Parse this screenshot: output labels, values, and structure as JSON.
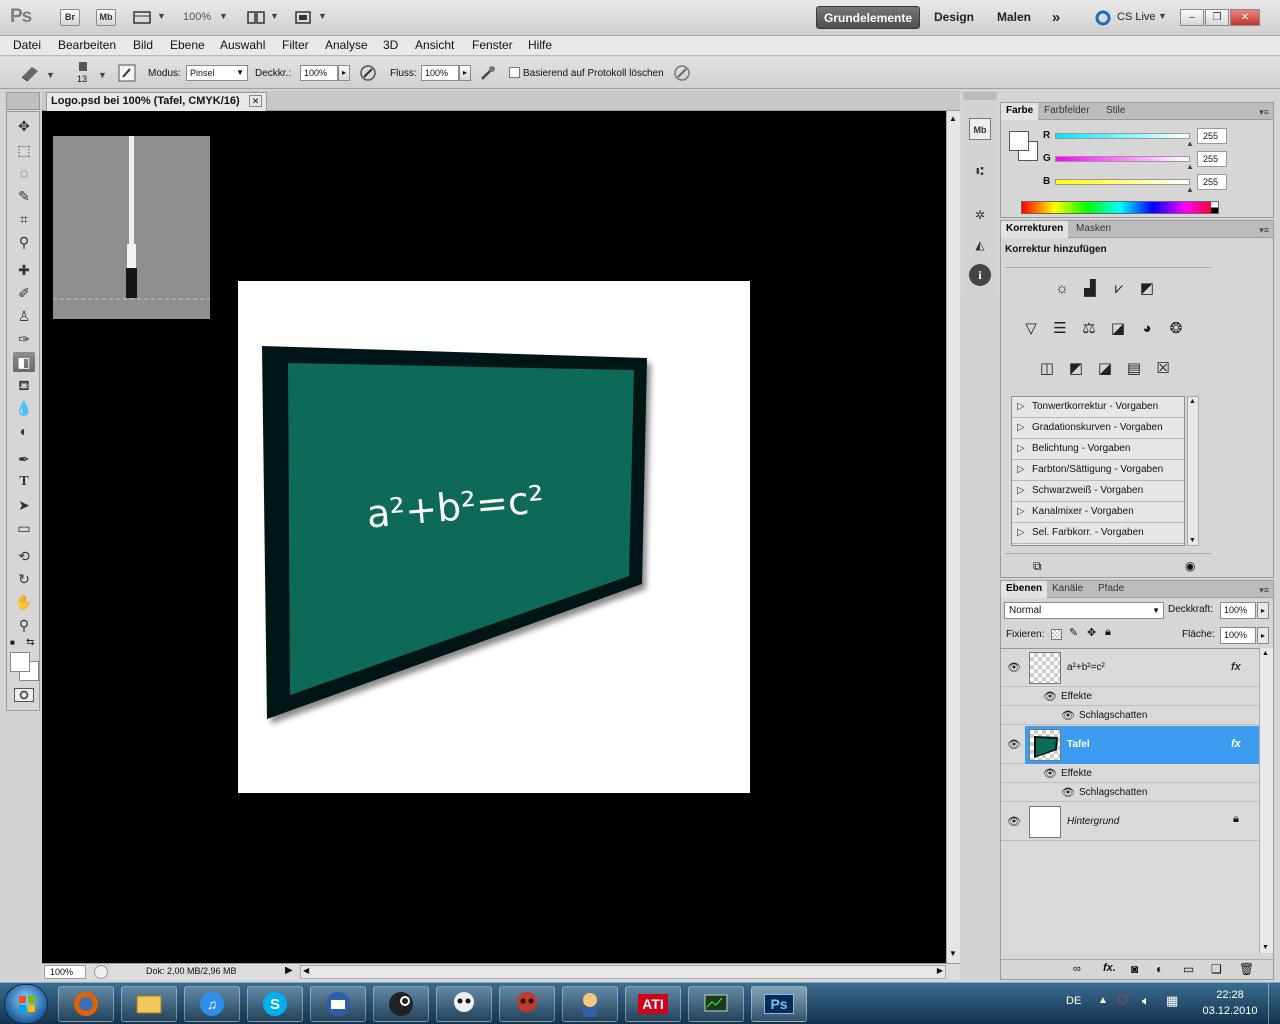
{
  "appbar": {
    "logo": "Ps",
    "bridge": "Br",
    "minibridge": "Mb",
    "zoom": "100%",
    "workspaces": [
      "Grundelemente",
      "Design",
      "Malen"
    ],
    "more": "»",
    "cslive": "CS Live"
  },
  "menu": [
    "Datei",
    "Bearbeiten",
    "Bild",
    "Ebene",
    "Auswahl",
    "Filter",
    "Analyse",
    "3D",
    "Ansicht",
    "Fenster",
    "Hilfe"
  ],
  "options": {
    "brush_size": "13",
    "mode_label": "Modus:",
    "mode_value": "Pinsel",
    "opacity_label": "Deckkr.:",
    "opacity_value": "100%",
    "flow_label": "Fluss:",
    "flow_value": "100%",
    "history_label": "Basierend auf Protokoll löschen"
  },
  "document": {
    "tab_title": "Logo.psd bei 100% (Tafel, CMYK/16)",
    "formula": "a²+b²=c²",
    "status_zoom": "100%",
    "status_doc": "Dok: 2,00 MB/2,96 MB"
  },
  "color_panel": {
    "tabs": [
      "Farbe",
      "Farbfelder",
      "Stile"
    ],
    "channels": [
      {
        "label": "R",
        "value": "255",
        "color": "#00e5ff"
      },
      {
        "label": "G",
        "value": "255",
        "color": "#ff00ff"
      },
      {
        "label": "B",
        "value": "255",
        "color": "#ffff00"
      }
    ]
  },
  "adjust_panel": {
    "tabs": [
      "Korrekturen",
      "Masken"
    ],
    "heading": "Korrektur hinzufügen",
    "presets": [
      "Tonwertkorrektur - Vorgaben",
      "Gradationskurven - Vorgaben",
      "Belichtung - Vorgaben",
      "Farbton/Sättigung - Vorgaben",
      "Schwarzweiß - Vorgaben",
      "Kanalmixer - Vorgaben",
      "Sel. Farbkorr. - Vorgaben"
    ]
  },
  "layers_panel": {
    "tabs": [
      "Ebenen",
      "Kanäle",
      "Pfade"
    ],
    "blend_mode": "Normal",
    "opacity_label": "Deckkraft:",
    "opacity_value": "100%",
    "lock_label": "Fixieren:",
    "fill_label": "Fläche:",
    "fill_value": "100%",
    "layers": [
      {
        "name": "a²+b²=c²",
        "effects": "Effekte",
        "effect": "Schlagschatten",
        "fx": "fx"
      },
      {
        "name": "Tafel",
        "effects": "Effekte",
        "effect": "Schlagschatten",
        "fx": "fx"
      },
      {
        "name": "Hintergrund"
      }
    ]
  },
  "taskbar": {
    "lang": "DE",
    "time": "22:28",
    "date": "03.12.2010",
    "apps": [
      "Firefox",
      "Explorer",
      "iTunes",
      "Skype",
      "Thunderbird",
      "Steam",
      "Game",
      "Game",
      "Fallout",
      "ATI",
      "Monitor",
      "Ps"
    ],
    "ati": "ATI",
    "ps": "Ps"
  },
  "colors": {
    "chalkboard": "#0c6a57",
    "frame": "#061512",
    "selection": "#3d9bf0"
  }
}
